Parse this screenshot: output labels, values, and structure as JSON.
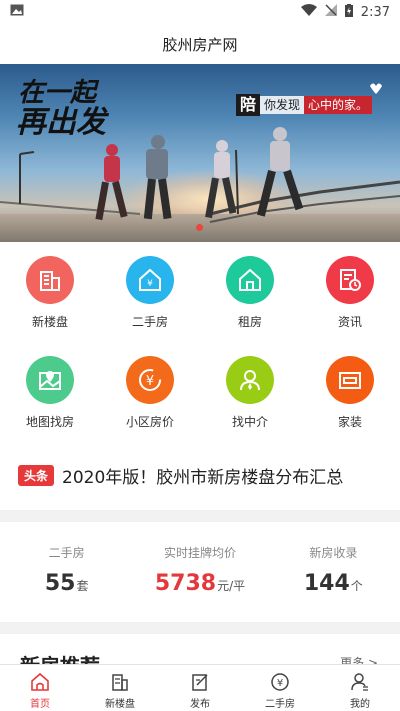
{
  "status_bar": {
    "time": "2:37"
  },
  "header": {
    "title": "胶州房产网"
  },
  "banner": {
    "slogan_line1": "在一起",
    "slogan_line2": "再出发",
    "tag_big": "陪",
    "tag_a": "你发现",
    "tag_b": "心中的家。"
  },
  "grid": {
    "items": [
      {
        "label": "新楼盘",
        "color": "#f2655f"
      },
      {
        "label": "二手房",
        "color": "#28b4ec"
      },
      {
        "label": "租房",
        "color": "#1ec99a"
      },
      {
        "label": "资讯",
        "color": "#f03a47"
      },
      {
        "label": "地图找房",
        "color": "#4ccb8c"
      },
      {
        "label": "小区房价",
        "color": "#f46a1b"
      },
      {
        "label": "找中介",
        "color": "#99cc15"
      },
      {
        "label": "家装",
        "color": "#f45c14"
      }
    ]
  },
  "headline": {
    "badge": "头条",
    "text": "2020年版！胶州市新房楼盘分布汇总"
  },
  "stats": [
    {
      "label": "二手房",
      "value": "55",
      "unit": "套"
    },
    {
      "label": "实时挂牌均价",
      "value": "5738",
      "unit": "元/平"
    },
    {
      "label": "新房收录",
      "value": "144",
      "unit": "个"
    }
  ],
  "section": {
    "title": "新房推荐",
    "more": "更多 >"
  },
  "tabbar": {
    "tabs": [
      {
        "label": "首页"
      },
      {
        "label": "新楼盘"
      },
      {
        "label": "发布"
      },
      {
        "label": "二手房"
      },
      {
        "label": "我的"
      }
    ]
  },
  "colors": {
    "accent": "#e4393c"
  }
}
